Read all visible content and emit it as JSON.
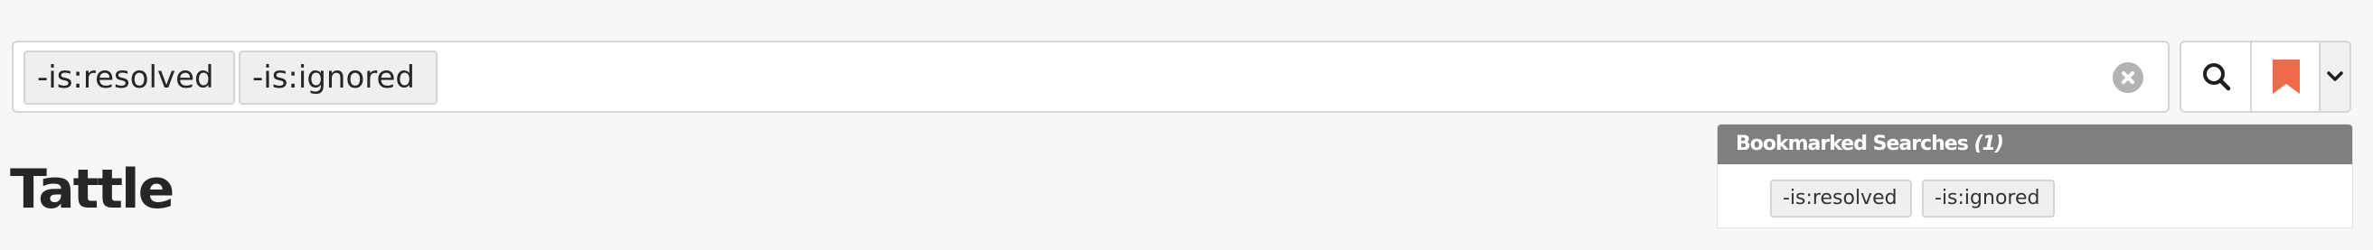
{
  "search": {
    "tokens": [
      "-is:resolved",
      "-is:ignored"
    ],
    "value": ""
  },
  "title": "Tattle",
  "bookmarks": {
    "header_label": "Bookmarked Searches",
    "header_count": "(1)",
    "saved_search_tokens": [
      "-is:resolved",
      "-is:ignored"
    ]
  },
  "icons": {
    "clear": "clear-icon",
    "search": "search-icon",
    "bookmark": "bookmark-icon",
    "dropdown": "chevron-down-icon"
  },
  "colors": {
    "bookmark_accent": "#f06a4a",
    "panel_header": "#7f7f7f",
    "background": "#f7f7f7"
  }
}
